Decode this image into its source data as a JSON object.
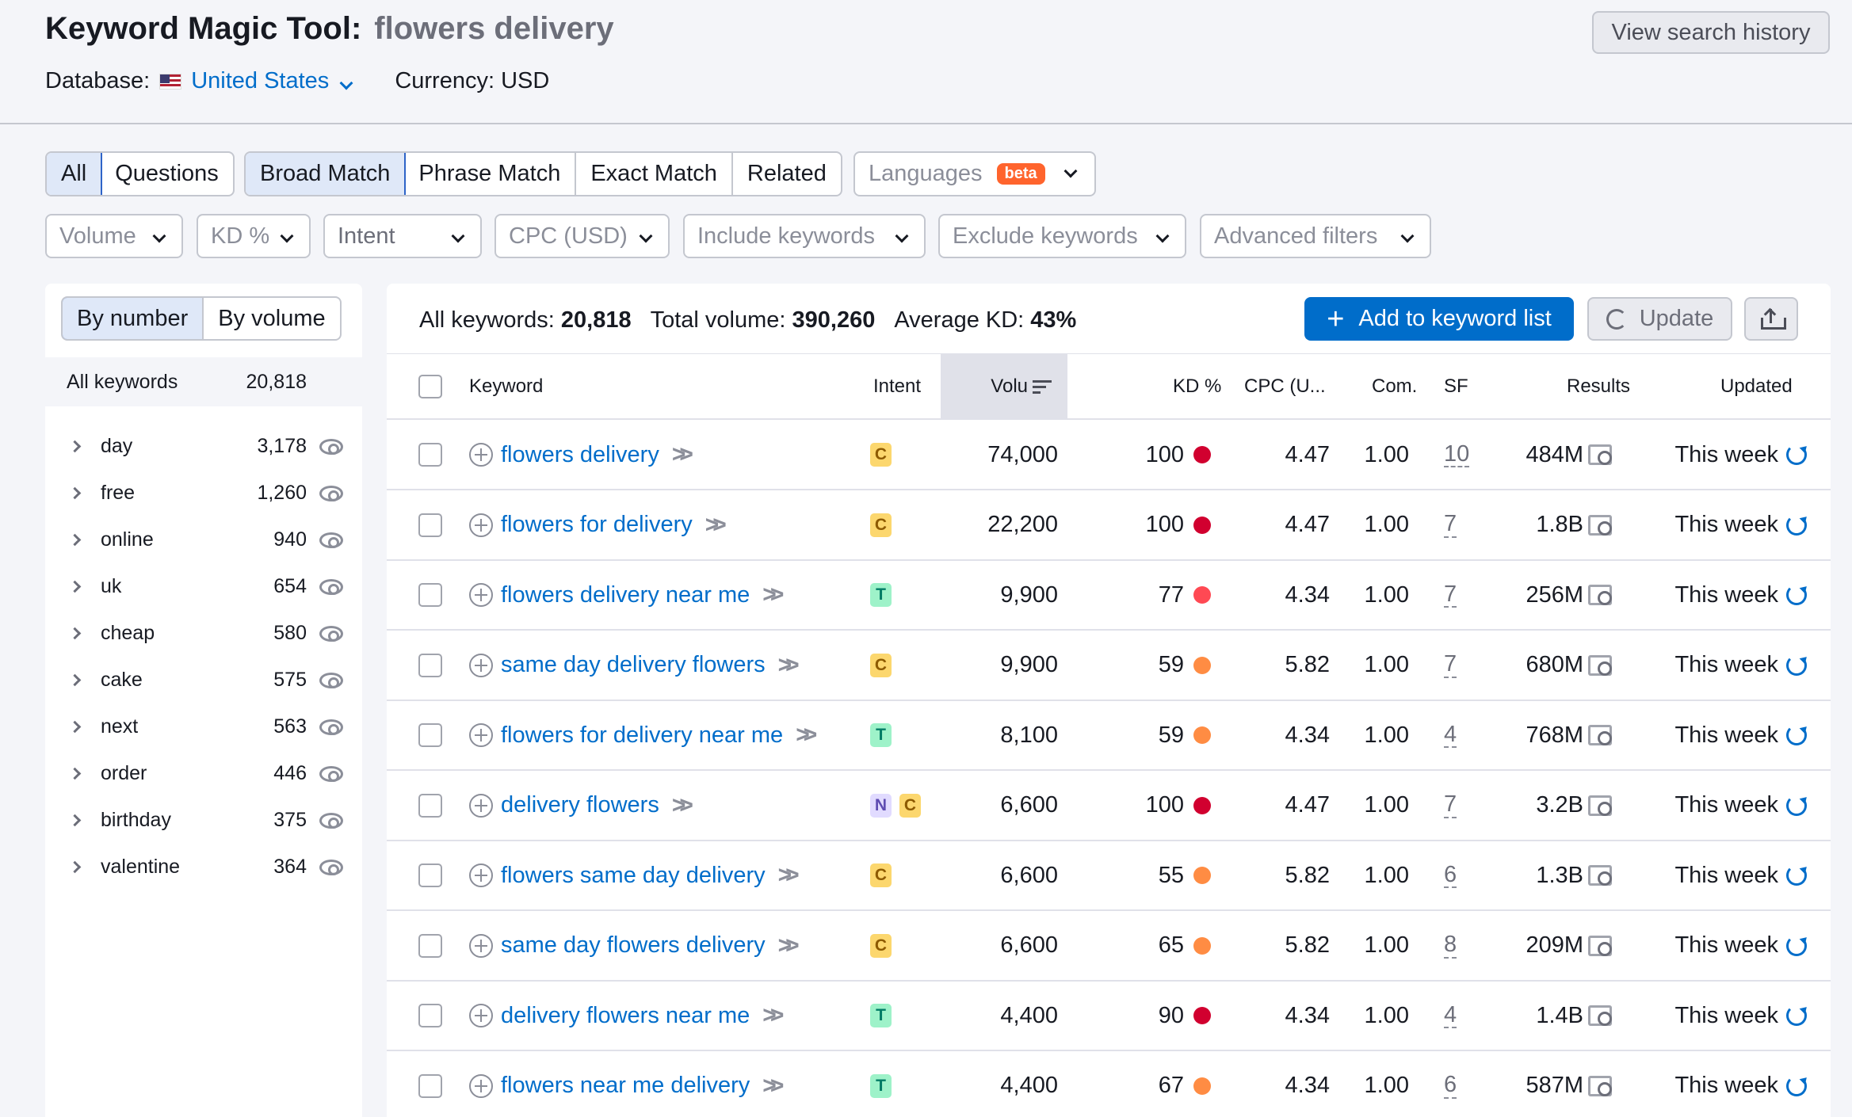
{
  "header": {
    "title": "Keyword Magic Tool:",
    "query": "flowers delivery",
    "database_label": "Database:",
    "database_value": "United States",
    "currency": "Currency: USD",
    "history_button": "View search history"
  },
  "tabs": {
    "all": "All",
    "questions": "Questions",
    "broad": "Broad Match",
    "phrase": "Phrase Match",
    "exact": "Exact Match",
    "related": "Related",
    "languages": "Languages",
    "beta": "beta"
  },
  "filters": {
    "volume": "Volume",
    "kd": "KD %",
    "intent": "Intent",
    "cpc": "CPC (USD)",
    "include": "Include keywords",
    "exclude": "Exclude keywords",
    "advanced": "Advanced filters"
  },
  "sidebar": {
    "by_number": "By number",
    "by_volume": "By volume",
    "all_label": "All keywords",
    "all_count": "20,818",
    "groups": [
      {
        "label": "day",
        "count": "3,178"
      },
      {
        "label": "free",
        "count": "1,260"
      },
      {
        "label": "online",
        "count": "940"
      },
      {
        "label": "uk",
        "count": "654"
      },
      {
        "label": "cheap",
        "count": "580"
      },
      {
        "label": "cake",
        "count": "575"
      },
      {
        "label": "next",
        "count": "563"
      },
      {
        "label": "order",
        "count": "446"
      },
      {
        "label": "birthday",
        "count": "375"
      },
      {
        "label": "valentine",
        "count": "364"
      }
    ]
  },
  "summary": {
    "all_label": "All keywords:",
    "all_value": "20,818",
    "volume_label": "Total volume:",
    "volume_value": "390,260",
    "kd_label": "Average KD:",
    "kd_value": "43%"
  },
  "actions": {
    "add": "Add to keyword list",
    "update": "Update"
  },
  "columns": {
    "keyword": "Keyword",
    "intent": "Intent",
    "volume": "Volu",
    "kd": "KD %",
    "cpc": "CPC (U...",
    "com": "Com.",
    "sf": "SF",
    "results": "Results",
    "updated": "Updated"
  },
  "colors": {
    "accent": "#006dca",
    "kd_red": "#d1002f",
    "kd_lightred": "#ff4953",
    "kd_orange": "#ff8c43"
  },
  "rows": [
    {
      "keyword": "flowers delivery",
      "intent": [
        "C"
      ],
      "volume": "74,000",
      "kd": "100",
      "kd_color": "#d1002f",
      "cpc": "4.47",
      "com": "1.00",
      "sf": "10",
      "results": "484M",
      "updated": "This week"
    },
    {
      "keyword": "flowers for delivery",
      "intent": [
        "C"
      ],
      "volume": "22,200",
      "kd": "100",
      "kd_color": "#d1002f",
      "cpc": "4.47",
      "com": "1.00",
      "sf": "7",
      "results": "1.8B",
      "updated": "This week"
    },
    {
      "keyword": "flowers delivery near me",
      "intent": [
        "T"
      ],
      "volume": "9,900",
      "kd": "77",
      "kd_color": "#ff4953",
      "cpc": "4.34",
      "com": "1.00",
      "sf": "7",
      "results": "256M",
      "updated": "This week"
    },
    {
      "keyword": "same day delivery flowers",
      "intent": [
        "C"
      ],
      "volume": "9,900",
      "kd": "59",
      "kd_color": "#ff8c43",
      "cpc": "5.82",
      "com": "1.00",
      "sf": "7",
      "results": "680M",
      "updated": "This week"
    },
    {
      "keyword": "flowers for delivery near me",
      "intent": [
        "T"
      ],
      "volume": "8,100",
      "kd": "59",
      "kd_color": "#ff8c43",
      "cpc": "4.34",
      "com": "1.00",
      "sf": "4",
      "results": "768M",
      "updated": "This week"
    },
    {
      "keyword": "delivery flowers",
      "intent": [
        "N",
        "C"
      ],
      "volume": "6,600",
      "kd": "100",
      "kd_color": "#d1002f",
      "cpc": "4.47",
      "com": "1.00",
      "sf": "7",
      "results": "3.2B",
      "updated": "This week"
    },
    {
      "keyword": "flowers same day delivery",
      "intent": [
        "C"
      ],
      "volume": "6,600",
      "kd": "55",
      "kd_color": "#ff8c43",
      "cpc": "5.82",
      "com": "1.00",
      "sf": "6",
      "results": "1.3B",
      "updated": "This week"
    },
    {
      "keyword": "same day flowers delivery",
      "intent": [
        "C"
      ],
      "volume": "6,600",
      "kd": "65",
      "kd_color": "#ff8c43",
      "cpc": "5.82",
      "com": "1.00",
      "sf": "8",
      "results": "209M",
      "updated": "This week"
    },
    {
      "keyword": "delivery flowers near me",
      "intent": [
        "T"
      ],
      "volume": "4,400",
      "kd": "90",
      "kd_color": "#d1002f",
      "cpc": "4.34",
      "com": "1.00",
      "sf": "4",
      "results": "1.4B",
      "updated": "This week"
    },
    {
      "keyword": "flowers near me delivery",
      "intent": [
        "T"
      ],
      "volume": "4,400",
      "kd": "67",
      "kd_color": "#ff8c43",
      "cpc": "4.34",
      "com": "1.00",
      "sf": "6",
      "results": "587M",
      "updated": "This week"
    }
  ]
}
